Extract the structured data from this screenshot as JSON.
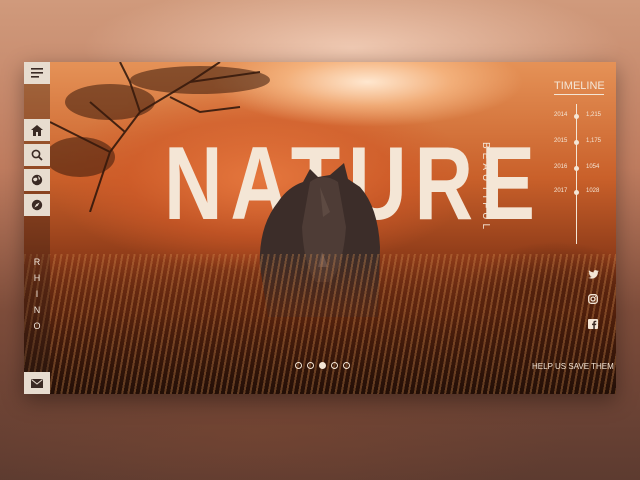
{
  "hero": {
    "title": "NATURE",
    "subtitle": "BEAUTIFUL"
  },
  "sidebar": {
    "vertical_label": [
      "R",
      "H",
      "I",
      "N",
      "O"
    ],
    "icons": [
      "menu-icon",
      "home-icon",
      "search-icon",
      "globe-icon",
      "compass-icon",
      "mail-icon"
    ]
  },
  "timeline": {
    "title": "TIMELINE",
    "entries": [
      {
        "year": "2014",
        "value": "1,215"
      },
      {
        "year": "2015",
        "value": "1,175"
      },
      {
        "year": "2016",
        "value": "1054"
      },
      {
        "year": "2017",
        "value": "1028"
      }
    ]
  },
  "social": [
    "twitter-icon",
    "instagram-icon",
    "facebook-icon"
  ],
  "cta": {
    "label": "HELP US SAVE THEM"
  },
  "slider": {
    "count": 5,
    "active_index": 2
  },
  "colors": {
    "accent": "#f4e6d6",
    "sidebar_button": "#e7dccf",
    "dark": "#3a2a24"
  }
}
